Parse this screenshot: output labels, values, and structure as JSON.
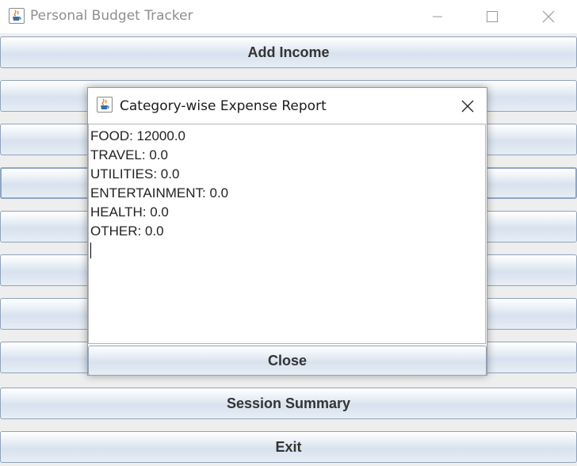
{
  "window": {
    "title": "Personal Budget Tracker",
    "icon": "java-cup-icon",
    "controls": [
      "minimize-icon",
      "maximize-icon",
      "close-icon"
    ]
  },
  "menu": {
    "add_income": "Add Income",
    "session_summary": "Session Summary",
    "exit": "Exit"
  },
  "dialog": {
    "title": "Category-wise Expense Report",
    "icon": "java-cup-icon",
    "report_lines": [
      "FOOD: 12000.0",
      "TRAVEL: 0.0",
      "UTILITIES: 0.0",
      "ENTERTAINMENT: 0.0",
      "HEALTH: 0.0",
      "OTHER: 0.0"
    ],
    "close_label": "Close"
  },
  "colors": {
    "button_border": "#8fa3bd",
    "button_gradient_mid": "#d8e2ee",
    "background": "#eeeeee"
  }
}
